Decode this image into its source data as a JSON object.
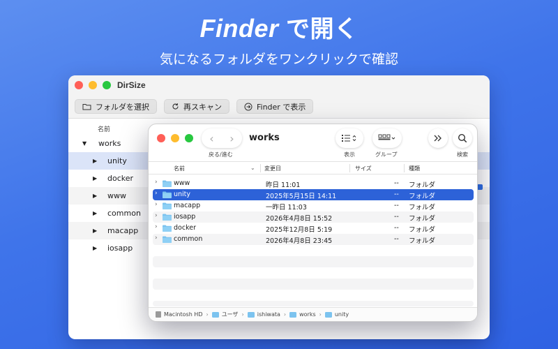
{
  "hero": {
    "title_finder": "Finder",
    "title_rest": "で開く",
    "subtitle": "気になるフォルダをワンクリックで確認"
  },
  "dirsize": {
    "app_title": "DirSize",
    "toolbar": {
      "select_folder": "フォルダを選択",
      "rescan": "再スキャン",
      "show_in_finder": "Finder で表示"
    },
    "column_name": "名前",
    "tree": [
      {
        "label": "works",
        "expanded": true
      },
      {
        "label": "unity"
      },
      {
        "label": "docker"
      },
      {
        "label": "www"
      },
      {
        "label": "common"
      },
      {
        "label": "macapp"
      },
      {
        "label": "iosapp"
      }
    ]
  },
  "finder": {
    "title": "works",
    "nav_label": "戻る/進む",
    "view_label": "表示",
    "group_label": "グループ",
    "search_label": "検索",
    "columns": {
      "name": "名前",
      "modified": "変更日",
      "size": "サイズ",
      "kind": "種類"
    },
    "rows": [
      {
        "name": "www",
        "date": "昨日 11:01",
        "size": "--",
        "kind": "フォルダ"
      },
      {
        "name": "unity",
        "date": "2025年5月15日 14:11",
        "size": "--",
        "kind": "フォルダ"
      },
      {
        "name": "macapp",
        "date": "一昨日 11:03",
        "size": "--",
        "kind": "フォルダ"
      },
      {
        "name": "iosapp",
        "date": "2026年4月8日 15:52",
        "size": "--",
        "kind": "フォルダ"
      },
      {
        "name": "docker",
        "date": "2025年12月8日 5:19",
        "size": "--",
        "kind": "フォルダ"
      },
      {
        "name": "common",
        "date": "2026年4月8日 23:45",
        "size": "--",
        "kind": "フォルダ"
      }
    ],
    "path": [
      "Macintosh HD",
      "ユーザ",
      "ishiwata",
      "works",
      "unity"
    ]
  },
  "colors": {
    "selection": "#2d62d8",
    "folder": "#7cc3ef",
    "background": "#3f74ea"
  }
}
